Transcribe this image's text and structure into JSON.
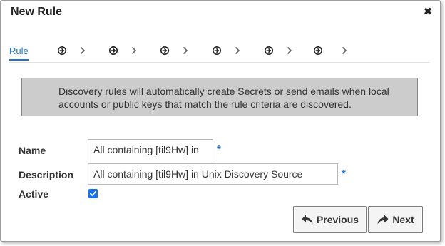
{
  "dialog": {
    "title": "New Rule",
    "close_icon": "close-icon"
  },
  "steps": {
    "active_label": "Rule",
    "step_icon": "circle-arrow-right-icon",
    "separator_icon": "chevron-right-icon",
    "count_after_active": 6
  },
  "info": {
    "text": "Discovery rules will automatically create Secrets or send emails when local accounts or public keys that match the rule criteria are discovered."
  },
  "form": {
    "name_label": "Name",
    "name_value": "All containing [til9Hw] in",
    "description_label": "Description",
    "description_value": "All containing [til9Hw] in Unix Discovery Source",
    "active_label": "Active",
    "active_checked": true,
    "required_marker": "*"
  },
  "buttons": {
    "previous_label": "Previous",
    "previous_icon": "reply-arrow-icon",
    "next_label": "Next",
    "next_icon": "forward-arrow-icon"
  },
  "colors": {
    "accent": "#1a73c8",
    "info_bg": "#cccccc",
    "checkbox": "#1a73e8"
  }
}
